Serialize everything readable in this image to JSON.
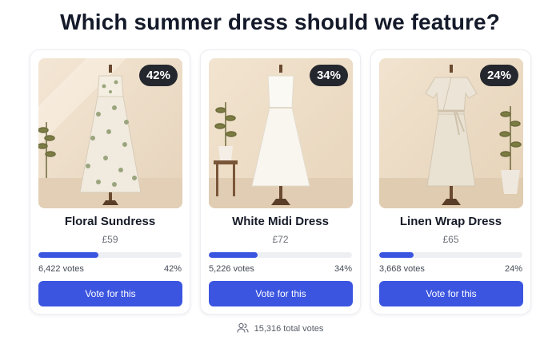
{
  "poll": {
    "question": "Which summer dress should we feature?",
    "total_votes_label": "15,316 total votes"
  },
  "options": [
    {
      "name": "Floral Sundress",
      "price": "£59",
      "percent_label": "42%",
      "percent": 42,
      "votes_label": "6,422 votes",
      "button_label": "Vote for this",
      "image": "floral-sundress-on-mannequin"
    },
    {
      "name": "White Midi Dress",
      "price": "£72",
      "percent_label": "34%",
      "percent": 34,
      "votes_label": "5,226 votes",
      "button_label": "Vote for this",
      "image": "white-midi-dress-on-mannequin"
    },
    {
      "name": "Linen Wrap Dress",
      "price": "£65",
      "percent_label": "24%",
      "percent": 24,
      "votes_label": "3,668 votes",
      "button_label": "Vote for this",
      "image": "linen-wrap-dress-on-mannequin"
    }
  ],
  "colors": {
    "accent": "#3b55e0",
    "badge_bg": "#24272e",
    "track_bg": "#eeeff2",
    "photo_bg": "#eedfcc"
  },
  "icons": {
    "total_votes": "users-icon"
  }
}
